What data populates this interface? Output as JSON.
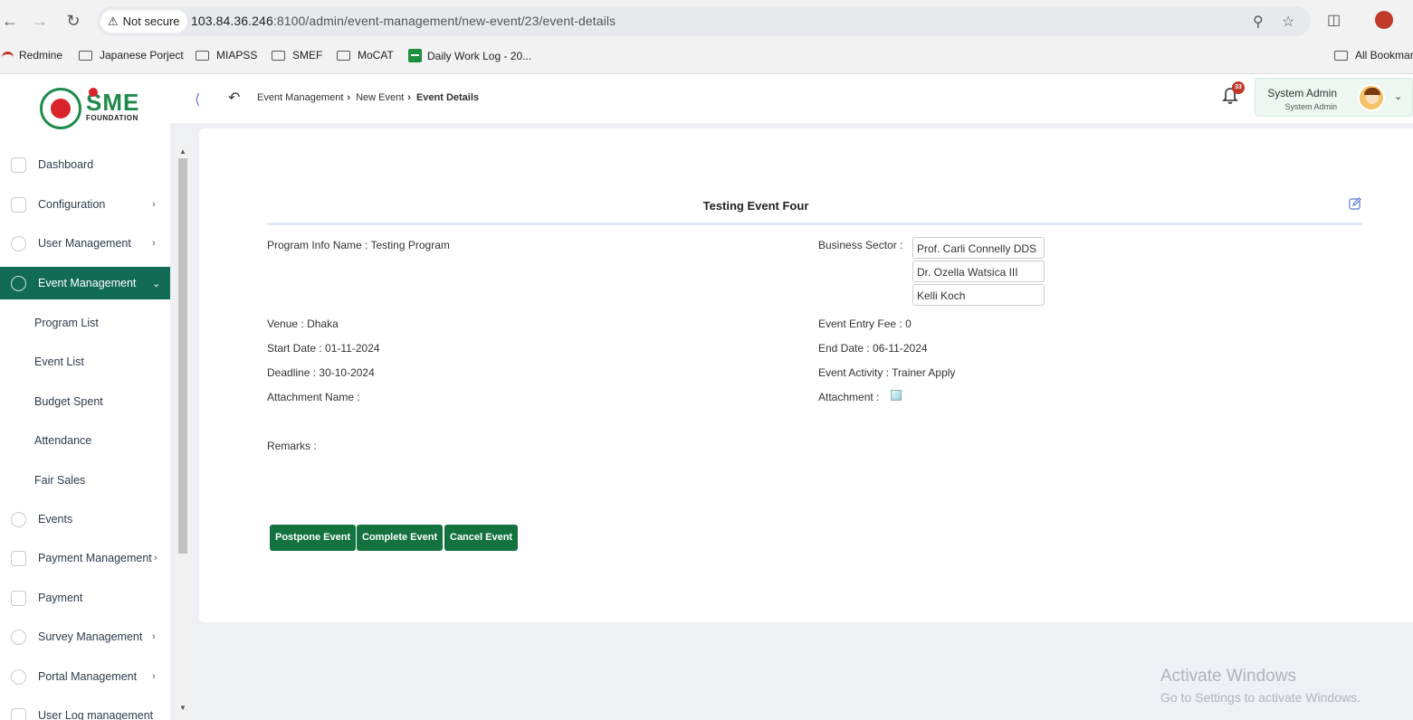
{
  "browser": {
    "security_label": "Not secure",
    "url_host": "103.84.36.246",
    "url_path": ":8100/admin/event-management/new-event/23/event-details",
    "bookmarks": [
      "Redmine",
      "Japanese Porject",
      "MIAPSS",
      "SMEF",
      "MoCAT",
      "Daily Work Log - 20...",
      "All Bookmar"
    ]
  },
  "logo": {
    "brand": "SME",
    "subtitle": "FOUNDATION"
  },
  "breadcrumb": {
    "level1": "Event Management",
    "level2": "New Event",
    "current": "Event Details"
  },
  "notifications": {
    "count": "33"
  },
  "user": {
    "name": "System Admin",
    "role": "System Admin"
  },
  "sidebar": {
    "items": [
      {
        "label": "Dashboard"
      },
      {
        "label": "Configuration"
      },
      {
        "label": "User Management"
      },
      {
        "label": "Event Management"
      },
      {
        "label": "Events"
      },
      {
        "label": "Payment Management"
      },
      {
        "label": "Payment"
      },
      {
        "label": "Survey Management"
      },
      {
        "label": "Portal Management"
      },
      {
        "label": "User Log management"
      }
    ],
    "sub_items": [
      {
        "label": "Program List"
      },
      {
        "label": "Event List"
      },
      {
        "label": "Budget Spent"
      },
      {
        "label": "Attendance"
      },
      {
        "label": "Fair Sales"
      }
    ]
  },
  "event": {
    "title": "Testing Event Four",
    "program_info_label": "Program Info Name :",
    "program_info_value": "Testing Program",
    "business_sector_label": "Business Sector :",
    "business_sectors": [
      "Prof. Carli Connelly DDS",
      "Dr. Ozella Watsica III",
      "Kelli Koch"
    ],
    "venue_label": "Venue :",
    "venue_value": "Dhaka",
    "entry_fee_label": "Event Entry Fee :",
    "entry_fee_value": "0",
    "start_date_label": "Start Date :",
    "start_date_value": "01-11-2024",
    "end_date_label": "End Date :",
    "end_date_value": "06-11-2024",
    "deadline_label": "Deadline :",
    "deadline_value": "30-10-2024",
    "activity_label": "Event Activity :",
    "activity_value": "Trainer Apply",
    "attachment_name_label": "Attachment Name :",
    "attachment_label": "Attachment :",
    "remarks_label": "Remarks :"
  },
  "actions": {
    "postpone": "Postpone Event",
    "complete": "Complete Event",
    "cancel": "Cancel Event"
  },
  "watermark": {
    "line1": "Activate Windows",
    "line2": "Go to Settings to activate Windows."
  },
  "colors": {
    "primary": "#13723d",
    "sidebar_active": "#126b54",
    "badge": "#c0392b"
  }
}
